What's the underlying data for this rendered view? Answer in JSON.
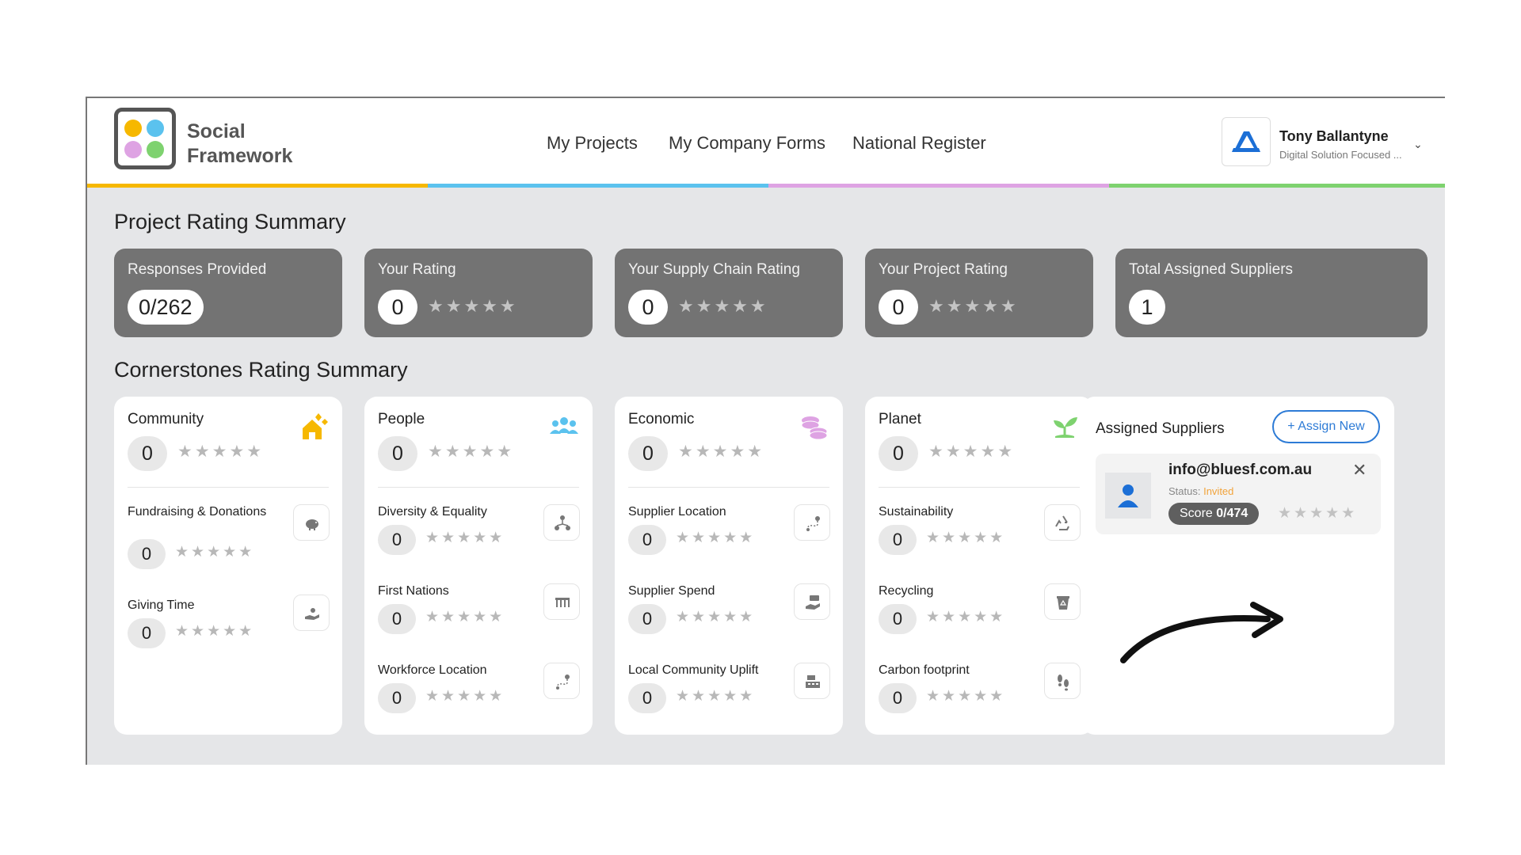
{
  "brand": {
    "line1": "Social",
    "line2": "Framework",
    "dot_colors": [
      "#f6b800",
      "#5bc2ee",
      "#dea3e3",
      "#7ed26f"
    ]
  },
  "nav": {
    "items": [
      "My Projects",
      "My Company Forms",
      "National Register"
    ]
  },
  "user": {
    "name": "Tony Ballantyne",
    "subtitle": "Digital Solution Focused ...",
    "chevron": "⌄"
  },
  "stripe_colors": [
    "#f6b800",
    "#5bc2ee",
    "#dea3e3",
    "#7ed26f"
  ],
  "project_summary": {
    "title": "Project Rating Summary",
    "cards": [
      {
        "label": "Responses Provided",
        "value": "0/262"
      },
      {
        "label": "Your Rating",
        "value": "0",
        "stars": "★★★★★"
      },
      {
        "label": "Your Supply Chain Rating",
        "value": "0",
        "stars": "★★★★★"
      },
      {
        "label": "Your Project Rating",
        "value": "0",
        "stars": "★★★★★"
      },
      {
        "label": "Total Assigned Suppliers",
        "value": "1"
      }
    ]
  },
  "cornerstones": {
    "title": "Cornerstones Rating Summary",
    "stars": "★★★★★",
    "cards": [
      {
        "title": "Community",
        "value": "0",
        "icon": "house-hands-icon",
        "icon_color": "#f6b800",
        "items": [
          {
            "label": "Fundraising & Donations",
            "value": "0",
            "icon": "piggy-bank-icon"
          },
          {
            "label": "Giving Time",
            "value": "0",
            "icon": "hand-heart-icon"
          }
        ]
      },
      {
        "title": "People",
        "value": "0",
        "icon": "people-group-icon",
        "icon_color": "#5bc2ee",
        "items": [
          {
            "label": "Diversity & Equality",
            "value": "0",
            "icon": "network-people-icon"
          },
          {
            "label": "First Nations",
            "value": "0",
            "icon": "didgeridoo-icon"
          },
          {
            "label": "Workforce Location",
            "value": "0",
            "icon": "route-pin-icon"
          }
        ]
      },
      {
        "title": "Economic",
        "value": "0",
        "icon": "coins-icon",
        "icon_color": "#dea3e3",
        "items": [
          {
            "label": "Supplier Location",
            "value": "0",
            "icon": "route-pin-icon"
          },
          {
            "label": "Supplier Spend",
            "value": "0",
            "icon": "hand-money-icon"
          },
          {
            "label": "Local Community Uplift",
            "value": "0",
            "icon": "cash-register-icon"
          }
        ]
      },
      {
        "title": "Planet",
        "value": "0",
        "icon": "sprout-icon",
        "icon_color": "#7ed26f",
        "items": [
          {
            "label": "Sustainability",
            "value": "0",
            "icon": "recycle-icon"
          },
          {
            "label": "Recycling",
            "value": "0",
            "icon": "recycle-bin-icon"
          },
          {
            "label": "Carbon footprint",
            "value": "0",
            "icon": "footprints-icon"
          }
        ]
      }
    ]
  },
  "assigned": {
    "title": "Assigned Suppliers",
    "button": "+ Assign New",
    "supplier": {
      "email": "info@bluesf.com.au",
      "status_label": "Status:",
      "status_value": "Invited",
      "score_label": "Score",
      "score_value": "0/474",
      "stars": "★★★★★"
    }
  }
}
